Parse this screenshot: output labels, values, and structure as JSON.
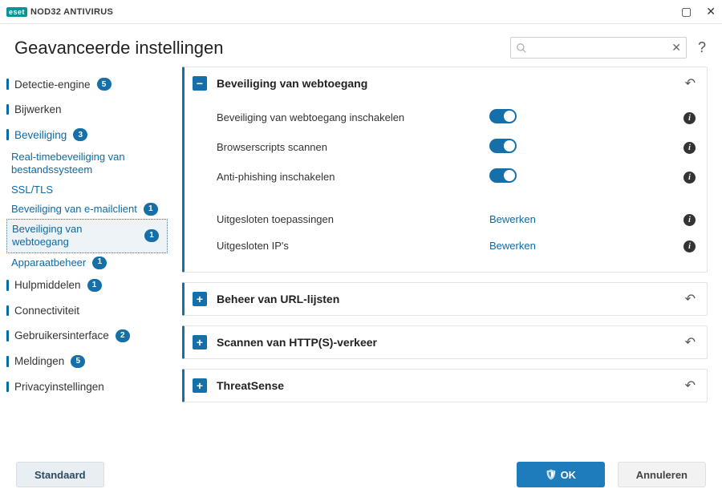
{
  "app": {
    "brand": "eset",
    "product": "NOD32 ANTIVIRUS"
  },
  "page_title": "Geavanceerde instellingen",
  "search": {
    "placeholder": ""
  },
  "sidebar": {
    "items": [
      {
        "label": "Detectie-engine",
        "badge": "5",
        "type": "top"
      },
      {
        "label": "Bijwerken",
        "type": "top"
      },
      {
        "label": "Beveiliging",
        "badge": "3",
        "type": "top",
        "expanded": true
      },
      {
        "label": "Real-timebeveiliging van bestandssysteem",
        "type": "sub"
      },
      {
        "label": "SSL/TLS",
        "type": "sub"
      },
      {
        "label": "Beveiliging van e-mailclient",
        "badge": "1",
        "type": "sub"
      },
      {
        "label": "Beveiliging van webtoegang",
        "badge": "1",
        "type": "sub",
        "selected": true
      },
      {
        "label": "Apparaatbeheer",
        "badge": "1",
        "type": "sub"
      },
      {
        "label": "Hulpmiddelen",
        "badge": "1",
        "type": "top"
      },
      {
        "label": "Connectiviteit",
        "type": "top"
      },
      {
        "label": "Gebruikersinterface",
        "badge": "2",
        "type": "top"
      },
      {
        "label": "Meldingen",
        "badge": "5",
        "type": "top"
      },
      {
        "label": "Privacyinstellingen",
        "type": "top"
      }
    ]
  },
  "panels": [
    {
      "title": "Beveiliging van webtoegang",
      "expanded": true,
      "settings": [
        {
          "label": "Beveiliging van webtoegang inschakelen",
          "type": "toggle",
          "value": true
        },
        {
          "label": "Browserscripts scannen",
          "type": "toggle",
          "value": true
        },
        {
          "label": "Anti-phishing inschakelen",
          "type": "toggle",
          "value": true
        },
        {
          "label": "Uitgesloten toepassingen",
          "type": "link",
          "action": "Bewerken"
        },
        {
          "label": "Uitgesloten IP's",
          "type": "link",
          "action": "Bewerken"
        }
      ]
    },
    {
      "title": "Beheer van URL-lijsten",
      "expanded": false
    },
    {
      "title": "Scannen van HTTP(S)-verkeer",
      "expanded": false
    },
    {
      "title": "ThreatSense",
      "expanded": false
    }
  ],
  "footer": {
    "default": "Standaard",
    "ok": "OK",
    "cancel": "Annuleren"
  }
}
